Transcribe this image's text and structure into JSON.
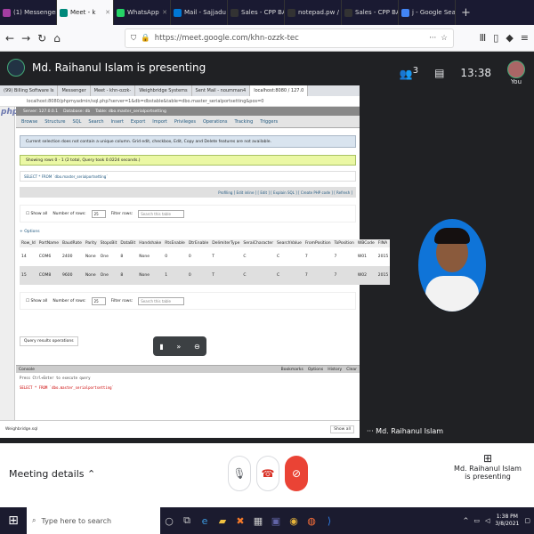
{
  "browser": {
    "tabs": [
      {
        "label": "(1) Messenger",
        "color": "#a33ea1",
        "active": false
      },
      {
        "label": "Meet - k",
        "color": "#00897b",
        "active": true
      },
      {
        "label": "WhatsApp",
        "color": "#25d366",
        "active": false
      },
      {
        "label": "Mail - Sajjadu",
        "color": "#0078d4",
        "active": false
      },
      {
        "label": "Sales - CPP BA",
        "color": "#333",
        "active": false
      },
      {
        "label": "notepad.pw /",
        "color": "#333",
        "active": false
      },
      {
        "label": "Sales - CPP BA",
        "color": "#333",
        "active": false
      },
      {
        "label": "j - Google Sea",
        "color": "#4285f4",
        "active": false
      }
    ],
    "url": "https://meet.google.com/khn-ozzk-tec"
  },
  "meet": {
    "presenting_banner": "Md. Raihanul Islam is presenting",
    "participant_count": "3",
    "time": "13:38",
    "you_label": "You",
    "tile_name": "Md. Raihanul Islam",
    "meeting_details": "Meeting details",
    "presenting_note": "Md. Raihanul Islam is presenting"
  },
  "shared": {
    "inner_tabs": [
      "(99) Billing Software Is",
      "Messenger",
      "Meet - khn-ozzk-",
      "Weighbridge Systems",
      "Sent Mail - noumman4",
      "localhost:8080 / 127.0"
    ],
    "inner_url": "localhost:8080/phpmyadmin/sql.php?server=1&db=dbstable&table=dbo.master_serialportsetting&pos=0",
    "breadcrumb": [
      "Server: 127.0.0.1",
      "Database: db",
      "Table: dbo.master_serialportsetting"
    ],
    "menu": [
      "Browse",
      "Structure",
      "SQL",
      "Search",
      "Insert",
      "Export",
      "Import",
      "Privileges",
      "Operations",
      "Tracking",
      "Triggers"
    ],
    "notice": "Current selection does not contain a unique column. Grid edit, checkbox, Edit, Copy and Delete features are not available.",
    "success": "Showing rows 0 - 1 (2 total, Query took 0.0224 seconds.)",
    "sql": "SELECT * FROM `dbo.master_serialportsetting`",
    "profiling": "Profiling [ Edit inline ] [ Edit ] [ Explain SQL ] [ Create PHP code ] [ Refresh ]",
    "show_all": "Show all",
    "num_rows_label": "Number of rows:",
    "num_rows": "25",
    "filter_label": "Filter rows:",
    "filter_placeholder": "Search this table",
    "options": "+ Options",
    "columns": [
      "Row_Id",
      "PortName",
      "BaudRate",
      "Parity",
      "StopsBit",
      "DataBit",
      "Handshake",
      "RtsEnable",
      "DtrEnable",
      "DelimiterType",
      "SeraiCharacter",
      "SearchValue",
      "FromPosition",
      "ToPosition",
      "WBCode",
      "FINA"
    ],
    "rows": [
      [
        "14",
        "COM6",
        "2400",
        "None",
        "One",
        "8",
        "None",
        "0",
        "0",
        "T",
        "C",
        "C",
        "7",
        "7",
        "W01",
        "2015"
      ],
      [
        "15",
        "COM8",
        "9600",
        "None",
        "One",
        "8",
        "None",
        "1",
        "0",
        "T",
        "C",
        "C",
        "7",
        "7",
        "W02",
        "2015"
      ]
    ],
    "query_results_ops": "Query results operations",
    "console_label": "Console",
    "console_tabs": [
      "Bookmarks",
      "Options",
      "History",
      "Clear"
    ],
    "console_hint": "Press Ctrl+Enter to execute query",
    "console_query": "SELECT * FROM `dbo.master_serialportsetting`",
    "download": "Weighbridge.sql",
    "show_all_dl": "Show all"
  },
  "taskbar": {
    "search_placeholder": "Type here to search",
    "time": "1:38 PM",
    "date": "3/8/2021"
  }
}
